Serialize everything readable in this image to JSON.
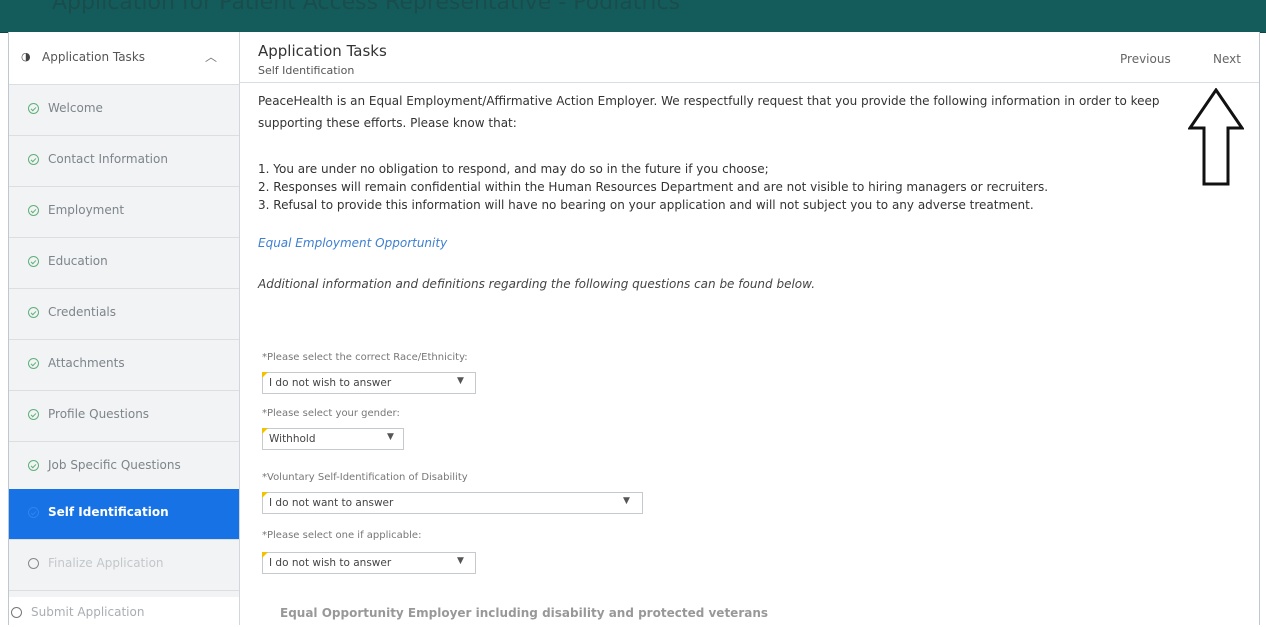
{
  "window": {
    "title": "Application for Patient Access Representative - Podiatrics"
  },
  "sidebar": {
    "header": {
      "label": "Application Tasks"
    },
    "items": [
      {
        "label": "Welcome",
        "state": "complete"
      },
      {
        "label": "Contact Information",
        "state": "complete"
      },
      {
        "label": "Employment",
        "state": "complete"
      },
      {
        "label": "Education",
        "state": "complete"
      },
      {
        "label": "Credentials",
        "state": "complete"
      },
      {
        "label": "Attachments",
        "state": "complete"
      },
      {
        "label": "Profile Questions",
        "state": "complete"
      },
      {
        "label": "Job Specific Questions",
        "state": "complete"
      },
      {
        "label": "Self Identification",
        "state": "active"
      },
      {
        "label": "Finalize Application",
        "state": "pending"
      },
      {
        "label": "Submit Application",
        "state": "pending"
      }
    ]
  },
  "header": {
    "title": "Application Tasks",
    "subtitle": "Self Identification",
    "previous_label": "Previous",
    "next_label": "Next"
  },
  "content": {
    "intro": "PeaceHealth is an Equal Employment/Affirmative Action Employer. We respectfully request that you provide the following information in order to keep supporting these efforts. Please know that:",
    "points": [
      "1. You are under no obligation to respond, and may do so in the future if you choose;",
      "2. Responses will remain confidential within the Human Resources Department and are not visible to hiring managers or recruiters.",
      "3. Refusal to provide this information will have no bearing on your application and will not subject you to any adverse treatment."
    ],
    "eeo_link": "Equal Employment Opportunity",
    "additional": "Additional information and definitions regarding the following questions can be found below."
  },
  "form": {
    "race": {
      "label": "*Please select the correct Race/Ethnicity:",
      "value": "I do not wish to answer"
    },
    "gender": {
      "label": "*Please select your gender:",
      "value": "Withhold"
    },
    "disability": {
      "label": "*Voluntary Self-Identification of Disability",
      "value": "I do not want to answer"
    },
    "applicable": {
      "label": "*Please select one if applicable:",
      "value": "I do not wish to answer"
    }
  },
  "footer_partial": "Equal Opportunity Employer including disability and protected veterans",
  "colors": {
    "topbar": "#145c5c",
    "active": "#1772e6",
    "complete": "#5fb07a",
    "link": "#3f7fd1"
  }
}
